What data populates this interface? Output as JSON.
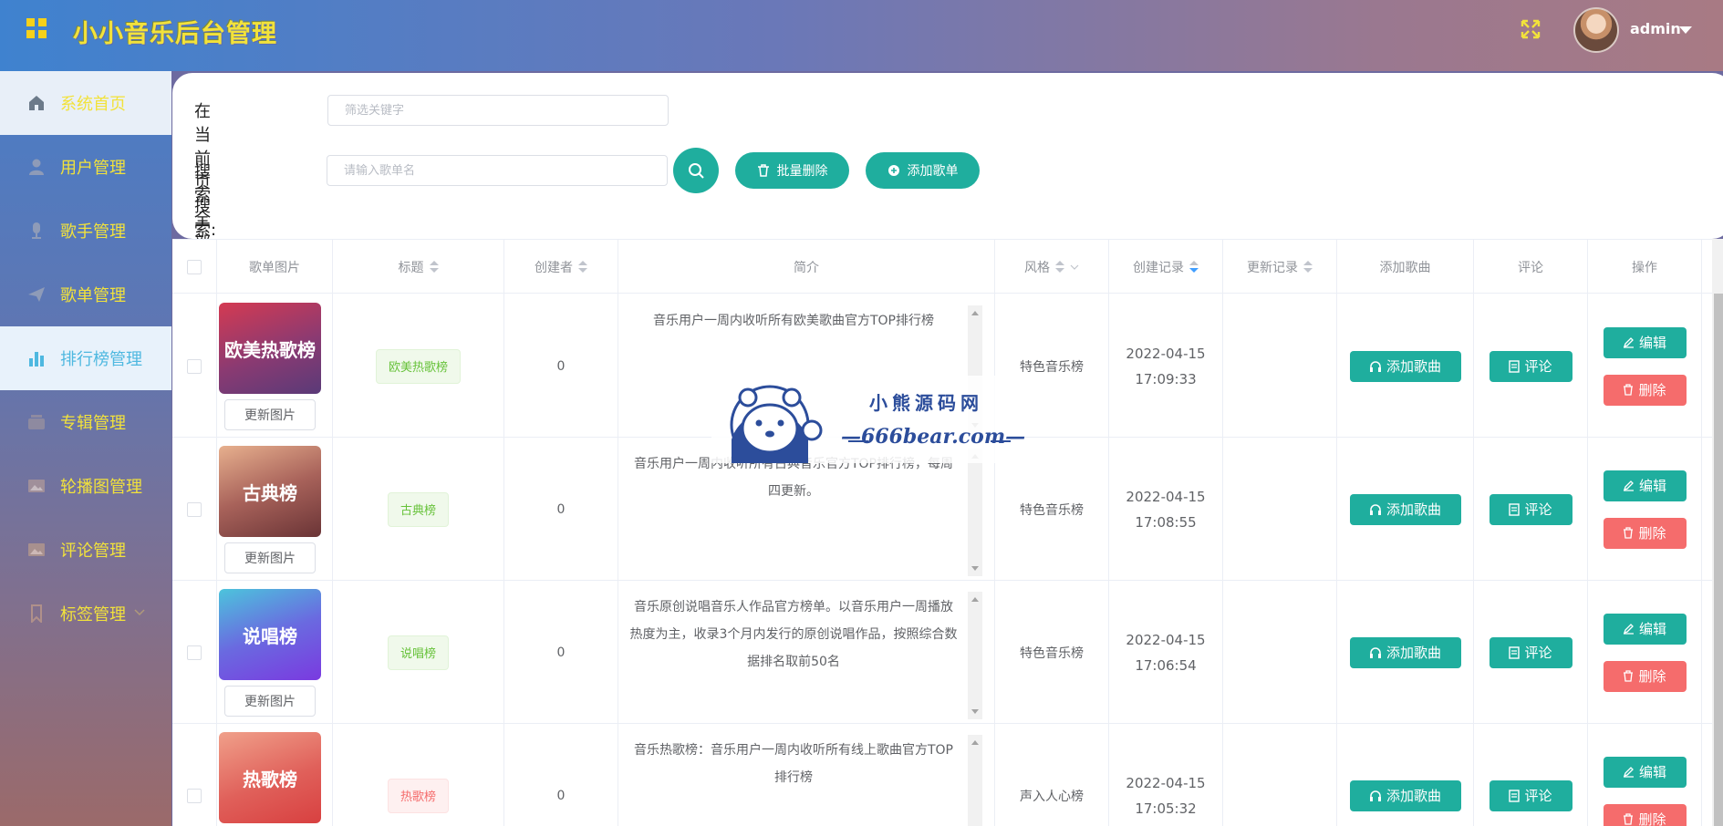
{
  "header": {
    "title": "小小音乐后台管理",
    "user": "admin"
  },
  "sidebar": {
    "items": [
      {
        "label": "系统首页",
        "icon": "home-icon"
      },
      {
        "label": "用户管理",
        "icon": "user-icon"
      },
      {
        "label": "歌手管理",
        "icon": "microphone-icon"
      },
      {
        "label": "歌单管理",
        "icon": "send-icon"
      },
      {
        "label": "排行榜管理",
        "icon": "bar-chart-icon"
      },
      {
        "label": "专辑管理",
        "icon": "folder-icon"
      },
      {
        "label": "轮播图管理",
        "icon": "picture-icon"
      },
      {
        "label": "评论管理",
        "icon": "picture-icon"
      },
      {
        "label": "标签管理",
        "icon": "bookmark-icon"
      }
    ]
  },
  "search": {
    "page_label": "在当前页搜索:",
    "page_placeholder": "筛选关键字",
    "all_label": "搜 索 全 部:",
    "all_placeholder": "请输入歌单名",
    "batch_delete": "批量删除",
    "add_playlist": "添加歌单"
  },
  "table": {
    "headers": {
      "cover": "歌单图片",
      "title": "标题",
      "creator": "创建者",
      "intro": "简介",
      "style": "风格",
      "created": "创建记录",
      "updated": "更新记录",
      "add_song": "添加歌曲",
      "comment": "评论",
      "action": "操作"
    },
    "update_image": "更新图片",
    "add_song_btn": "添加歌曲",
    "comment_btn": "评论",
    "edit_btn": "编辑",
    "delete_btn": "删除",
    "rows": [
      {
        "cover_text": "欧美热歌榜",
        "title": "欧美热歌榜",
        "creator": "0",
        "intro": "音乐用户一周内收听所有欧美歌曲官方TOP排行榜",
        "style": "特色音乐榜",
        "created": "2022-04-15 17:09:33",
        "updated": ""
      },
      {
        "cover_text": "古典榜",
        "title": "古典榜",
        "creator": "0",
        "intro": "音乐用户一周内收听所有古典音乐官方TOP排行榜，每周四更新。",
        "style": "特色音乐榜",
        "created": "2022-04-15 17:08:55",
        "updated": ""
      },
      {
        "cover_text": "说唱榜",
        "title": "说唱榜",
        "creator": "0",
        "intro": "音乐原创说唱音乐人作品官方榜单。以音乐用户一周播放热度为主，收录3个月内发行的原创说唱作品，按照综合数据排名取前50名",
        "style": "特色音乐榜",
        "created": "2022-04-15 17:06:54",
        "updated": ""
      },
      {
        "cover_text": "热歌榜",
        "title": "热歌榜",
        "creator": "0",
        "intro": "音乐热歌榜：音乐用户一周内收听所有线上歌曲官方TOP排行榜",
        "style": "声入人心榜",
        "created": "2022-04-15 17:05:32",
        "updated": ""
      }
    ]
  },
  "watermark": {
    "line1": "小熊源码网",
    "line2": "—666bear.com—"
  },
  "colors": {
    "teal": "#1fae9e",
    "danger": "#f56c6c",
    "title_yellow": "#f2e23b"
  }
}
